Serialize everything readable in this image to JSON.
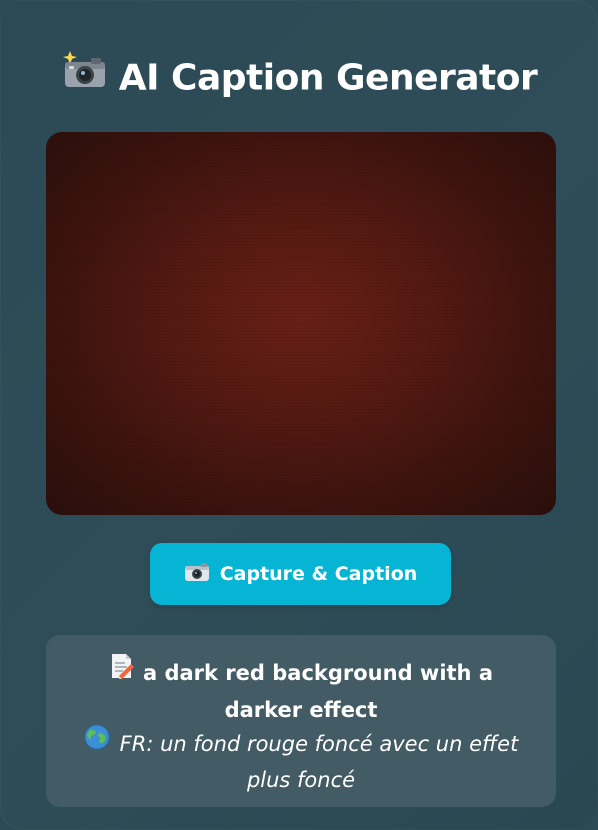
{
  "header": {
    "title": "AI Caption Generator",
    "icon": "camera-with-flash-icon"
  },
  "preview": {
    "description_color": "#561a12"
  },
  "capture_button": {
    "label": "Capture & Caption",
    "icon": "camera-icon",
    "color": "#06b4d4"
  },
  "result": {
    "caption_en": "a dark red background with a darker effect",
    "caption_en_icon": "memo-icon",
    "caption_fr": "FR: un fond rouge foncé avec un effet plus foncé",
    "caption_fr_icon": "globe-icon"
  },
  "colors": {
    "background": "#2c4a55",
    "result_panel": "#435b64"
  }
}
